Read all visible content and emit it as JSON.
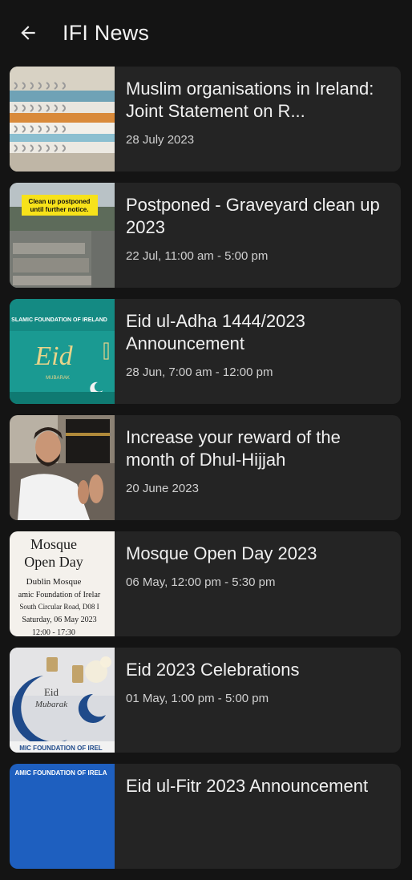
{
  "header": {
    "title": "IFI News",
    "back_icon": "arrow-left-icon"
  },
  "colors": {
    "background": "#141414",
    "card": "#242424",
    "text": "#f0f0f0"
  },
  "articles": [
    {
      "title": "Muslim organisations in Ireland: Joint Statement on R...",
      "date": "28 July 2023",
      "thumbnail": "spiral-notebooks"
    },
    {
      "title": "Postponed - Graveyard clean up 2023",
      "date": "22 Jul, 11:00 am - 5:00 pm",
      "thumbnail": "graveyard",
      "thumb_text": [
        "Clean up postponed",
        "until further notice."
      ]
    },
    {
      "title": "Eid ul-Adha 1444/2023 Announcement",
      "date": "28 Jun, 7:00 am - 12:00 pm",
      "thumbnail": "eid-mubarak-teal",
      "thumb_text": [
        "SLAMIC FOUNDATION OF IRELAND",
        "Eid",
        "MUBARAK"
      ]
    },
    {
      "title": "Increase your reward of the month of Dhul-Hijjah",
      "date": "20 June 2023",
      "thumbnail": "man-praying-kaaba"
    },
    {
      "title": "Mosque Open Day 2023",
      "date": "06 May, 12:00 pm - 5:30 pm",
      "thumbnail": "open-day-poster",
      "thumb_text": [
        "Mosque",
        "Open Day",
        "Dublin Mosque",
        "amic Foundation of Irelar",
        "South Circular Road, D08 I",
        "Saturday, 06 May 2023",
        "12:00 - 17:30"
      ]
    },
    {
      "title": "Eid 2023 Celebrations",
      "date": "01 May, 1:00 pm - 5:00 pm",
      "thumbnail": "eid-crescent-lanterns",
      "thumb_text": [
        "Eid",
        "Mubarak",
        "MIC FOUNDATION OF IREL"
      ]
    },
    {
      "title": "Eid ul-Fitr 2023 Announcement",
      "date": "",
      "thumbnail": "blue-banner",
      "thumb_text": [
        "AMIC FOUNDATION OF IRELA"
      ]
    }
  ]
}
